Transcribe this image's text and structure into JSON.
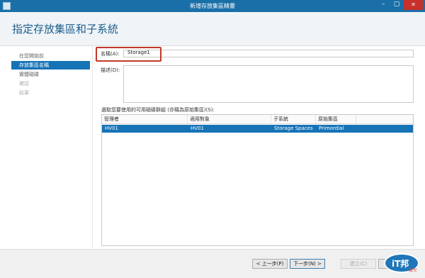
{
  "window": {
    "title": "新增存放集區精靈",
    "min_icon": "minimize-icon",
    "max_icon": "maximize-icon",
    "close_icon": "close-icon"
  },
  "page": {
    "title": "指定存放集區和子系統"
  },
  "nav": {
    "items": [
      {
        "label": "在您開始前",
        "state": "normal"
      },
      {
        "label": "存放集區名稱",
        "state": "active"
      },
      {
        "label": "實體磁碟",
        "state": "normal"
      },
      {
        "label": "確認",
        "state": "disabled"
      },
      {
        "label": "結果",
        "state": "disabled"
      }
    ]
  },
  "form": {
    "name_label": "名稱(A):",
    "name_value": "Storage1",
    "description_label": "描述(D):",
    "description_value": "",
    "group_label": "選取您要使用的可用磁碟群組 (亦稱為原始集區)(S):"
  },
  "table": {
    "headers": [
      "管理者",
      "適用對象",
      "子系統",
      "原始集區"
    ],
    "rows": [
      {
        "cells": [
          "HV01",
          "HV01",
          "Storage Spaces",
          "Primordial"
        ],
        "selected": true
      }
    ]
  },
  "buttons": {
    "prev": "< 上一步(P)",
    "next": "下一步(N) >",
    "create": "建立(C)",
    "cancel": "取消"
  },
  "watermark": {
    "text": "iT邦",
    "subtext": "幫忙"
  },
  "colors": {
    "accent": "#1573b6",
    "titlebar": "#1a6fa8",
    "close": "#c7302b",
    "highlight": "#c0392b"
  }
}
